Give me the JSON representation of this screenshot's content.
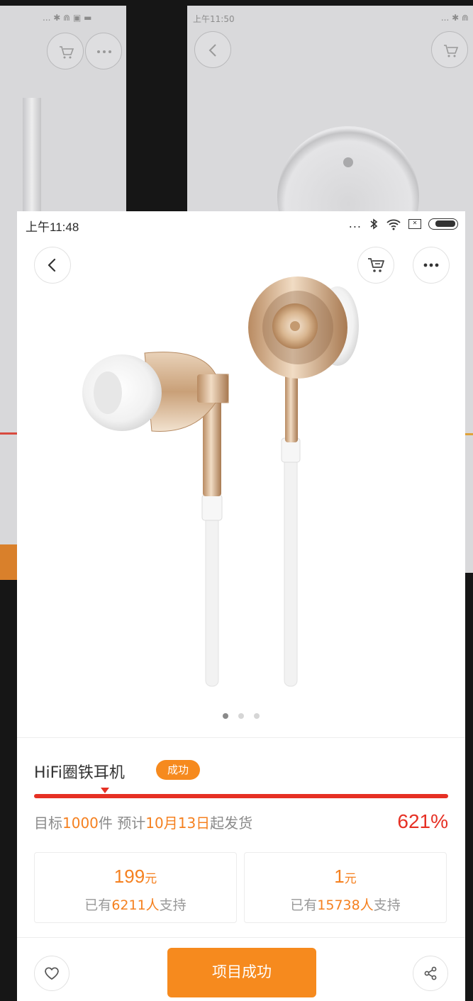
{
  "background_left": {
    "status_glyphs": "... ✱ ⋒ ▣ ▬"
  },
  "background_right": {
    "time": "上午11:50",
    "status_glyphs": "... ✱ ⋒"
  },
  "status_bar": {
    "time": "上午11:48",
    "signal_dots": "..."
  },
  "header": {
    "back_icon": "chevron-left-icon",
    "cart_icon": "cart-icon",
    "more_icon": "more-dots-icon"
  },
  "carousel": {
    "total": 3,
    "active_index": 0
  },
  "product": {
    "title": "HiFi圈铁耳机",
    "status_badge": "成功",
    "progress_percent": 621,
    "goal_prefix": "目标",
    "goal_count": "1000",
    "goal_unit": "件",
    "ship_prefix": "预计",
    "ship_date": "10月13日",
    "ship_suffix": "起发货",
    "percent_label": "621%"
  },
  "tiers": [
    {
      "price": "199",
      "unit": "元",
      "support_prefix": "已有",
      "supporters": "6211人",
      "support_suffix": "支持"
    },
    {
      "price": "1",
      "unit": "元",
      "support_prefix": "已有",
      "supporters": "15738人",
      "support_suffix": "支持"
    }
  ],
  "bottom_bar": {
    "fav_icon": "heart-icon",
    "main_button": "项目成功",
    "share_icon": "share-icon"
  },
  "colors": {
    "accent_orange": "#f68a1e",
    "progress_red": "#e63024",
    "highlight_orange": "#f5801f"
  }
}
